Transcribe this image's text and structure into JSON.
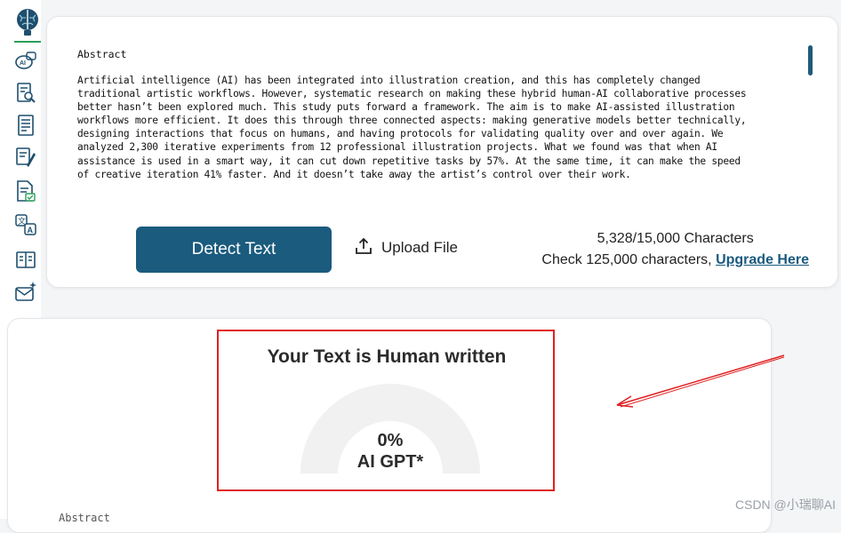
{
  "sidebar": {
    "icons": [
      "brain-logo-icon",
      "ai-chat-icon",
      "document-search-icon",
      "document-list-icon",
      "document-edit-icon",
      "document-check-icon",
      "translate-icon",
      "book-icon",
      "mail-sparkle-icon"
    ],
    "accent": "#2e9e5b"
  },
  "editor": {
    "title": "Abstract",
    "lines": [
      "Artificial intelligence (AI) has been integrated into illustration creation, and this has completely changed",
      "traditional artistic workflows. However, systematic research on making these hybrid human-AI collaborative processes",
      "better hasn’t been explored much. This study puts forward a framework. The aim is to make AI-assisted illustration",
      "workflows more efficient. It does this through three connected aspects: making generative models better technically,",
      "designing interactions that focus on humans, and having protocols for validating quality over and over again. We",
      "analyzed 2,300 iterative experiments from 12 professional illustration projects. What we found was that when AI",
      "assistance is used in a smart way, it can cut down repetitive tasks by 57%. At the same time, it can make the speed",
      "of creative iteration 41% faster. And it doesn’t take away the artist’s control over their work."
    ]
  },
  "actions": {
    "detect_label": "Detect Text",
    "upload_label": "Upload File",
    "char_count": "5,328/15,000 Characters",
    "check_text": "Check 125,000 characters,",
    "upgrade_link": "Upgrade Here",
    "primary_color": "#1a5b7e"
  },
  "result": {
    "title": "Your Text is Human written",
    "percent": "0%",
    "percent_value": 0,
    "label": "AI GPT*",
    "annotation_color": "#e02020"
  },
  "below": {
    "peek_text": "Abstract"
  },
  "watermark": "CSDN @小瑞聊AI"
}
